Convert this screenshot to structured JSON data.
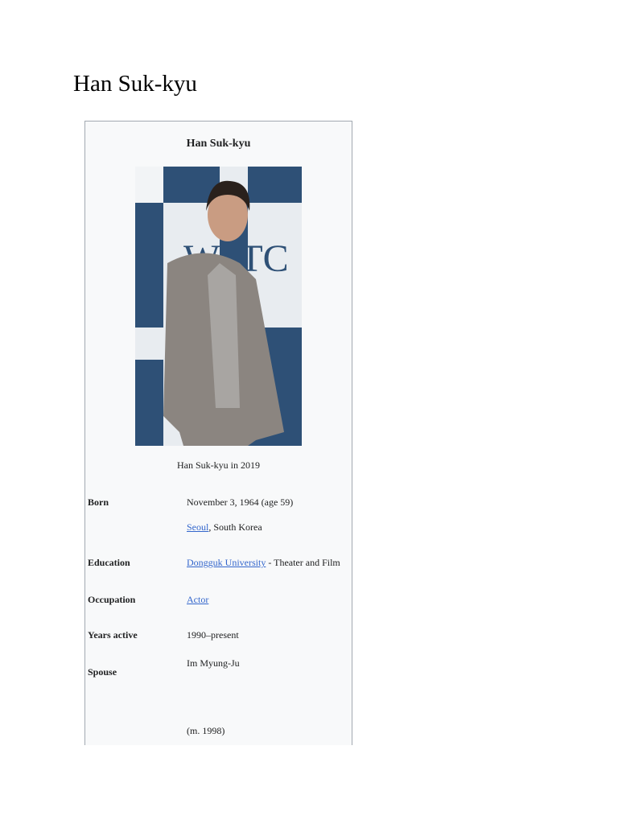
{
  "page_title": "Han Suk-kyu",
  "infobox": {
    "title": "Han Suk-kyu",
    "caption": "Han Suk-kyu in 2019",
    "born_label": "Born",
    "born_date": "November 3, 1964 (age 59)",
    "born_place_link": "Seoul",
    "born_place_rest": ", South Korea",
    "education_label": "Education",
    "education_link": "Dongguk University",
    "education_rest": " - Theater and Film",
    "occupation_label": "Occupation",
    "occupation_link": "Actor",
    "years_label": "Years active",
    "years_value": "1990–present",
    "spouse_label": "Spouse",
    "spouse_name": "Im Myung-Ju",
    "spouse_married": "(m. 1998)"
  }
}
